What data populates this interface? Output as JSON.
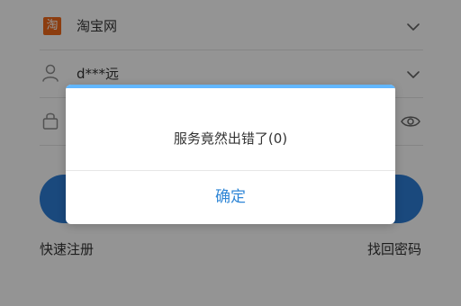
{
  "login": {
    "site": {
      "logo_glyph": "淘",
      "label": "淘宝网"
    },
    "user": {
      "value": "d***远"
    },
    "password": {
      "value": ""
    },
    "links": {
      "register": "快速注册",
      "forgot": "找回密码"
    }
  },
  "dialog": {
    "message": "服务竟然出错了(0)",
    "confirm": "确定"
  },
  "colors": {
    "accent": "#2d7fd8",
    "dialog_top_bar": "#62b7ff",
    "site_logo": "#f26a1b"
  },
  "icons": {
    "site": "taobao-logo",
    "user": "person-icon",
    "password": "lock-icon",
    "toggle_visibility": "eye-icon",
    "dropdown": "chevron-down-icon"
  }
}
